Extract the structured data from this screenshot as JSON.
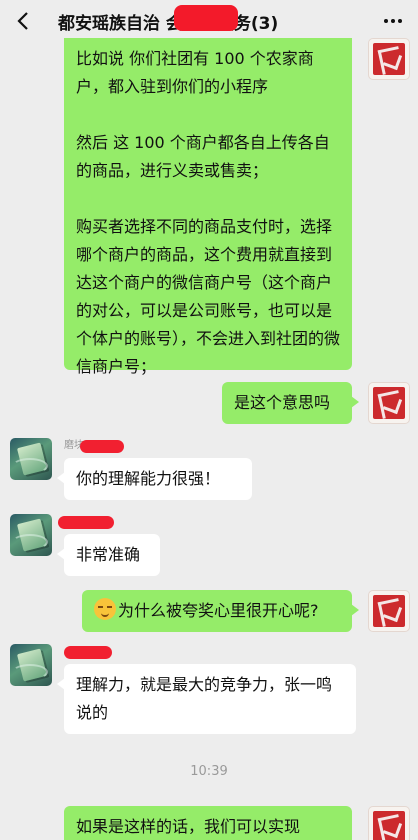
{
  "header": {
    "title": "都安瑶族自治                会工作服务(3)",
    "back_icon": "chevron-left-icon",
    "more_icon": "more-icon"
  },
  "messages": [
    {
      "side": "me",
      "paragraphs": [
        "比如说 你们社团有 100 个农家商户，都入驻到你们的小程序",
        "然后 这 100 个商户都各自上传各自的商品，进行义卖或售卖；",
        "购买者选择不同的商品支付时，选择哪个商户的商品，这个费用就直接到达这个商户的微信商户号（这个商户的对公，可以是公司账号，也可以是个体户的账号），不会进入到社团的微信商户号；"
      ]
    },
    {
      "side": "me",
      "text": "是这个意思吗"
    },
    {
      "side": "other",
      "sender_hint": "磨块",
      "text": "你的理解能力很强！"
    },
    {
      "side": "other",
      "text": "非常准确"
    },
    {
      "side": "me",
      "text": "为什么被夸奖心里很开心呢?",
      "emoji": "smiling-face-icon"
    },
    {
      "side": "other",
      "text": "理解力，就是最大的竞争力，张一鸣说的"
    },
    {
      "side": "me",
      "text": "如果是这样的话，我们可以实现"
    }
  ],
  "timestamp": "10:39",
  "colors": {
    "background": "#ededed",
    "bubble_me": "#95ec69",
    "bubble_other": "#ffffff",
    "redaction": "#f12030",
    "timestamp": "#9a9a9a"
  }
}
